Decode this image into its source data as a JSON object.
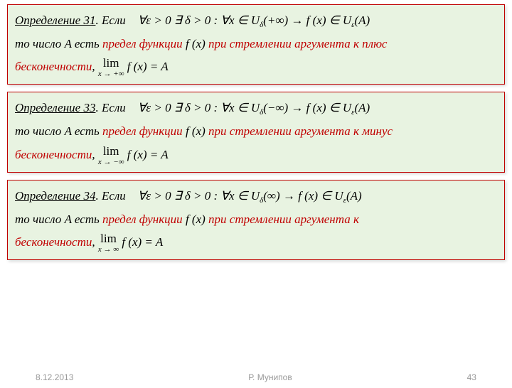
{
  "defs": [
    {
      "title": "Определение 31",
      "esli": ". Если",
      "cond": "∀ε > 0 ∃ δ > 0 :   ∀x ∈ U",
      "sub1": "δ",
      "condB": "(+∞)  →  f (x) ∈ U",
      "sub2": "ε",
      "condC": "(A)",
      "row2a": "то число  ",
      "A": "A",
      "row2b": "  есть ",
      "red": "предел функции",
      "fx": " f (x) ",
      "red2": "при стремлении аргумента к плюс",
      "row3red": "бесконечности",
      "comma": ",  ",
      "limSub": "x → +∞",
      "limExpr": " f (x) = A"
    },
    {
      "title": "Определение 33",
      "esli": ". Если",
      "cond": "∀ε > 0 ∃ δ > 0 :   ∀x ∈ U",
      "sub1": "δ",
      "condB": "(−∞)  →  f (x) ∈ U",
      "sub2": "ε",
      "condC": "(A)",
      "row2a": "то число  ",
      "A": "A",
      "row2b": "  есть ",
      "red": "предел функции",
      "fx": " f (x) ",
      "red2": "при стремлении аргумента к минус",
      "row3red": "бесконечности",
      "comma": ",  ",
      "limSub": "x → −∞",
      "limExpr": " f (x) = A"
    },
    {
      "title": "Определение 34",
      "esli": ". Если",
      "cond": "∀ε > 0 ∃ δ > 0 :   ∀x ∈ U",
      "sub1": "δ",
      "condB": "(∞)  →  f (x) ∈ U",
      "sub2": "ε",
      "condC": "(A)",
      "row2a": "то число  ",
      "A": "A",
      "row2b": "  есть ",
      "red": "предел функции",
      "fx": " f (x) ",
      "red2": "при стремлении аргумента к",
      "row3red": "бесконечности",
      "comma": ",  ",
      "limSub": "x → ∞",
      "limExpr": " f (x) = A"
    }
  ],
  "limWord": "lim",
  "footer": {
    "date": "8.12.2013",
    "author": "Р. Мунипов",
    "page": "43"
  }
}
